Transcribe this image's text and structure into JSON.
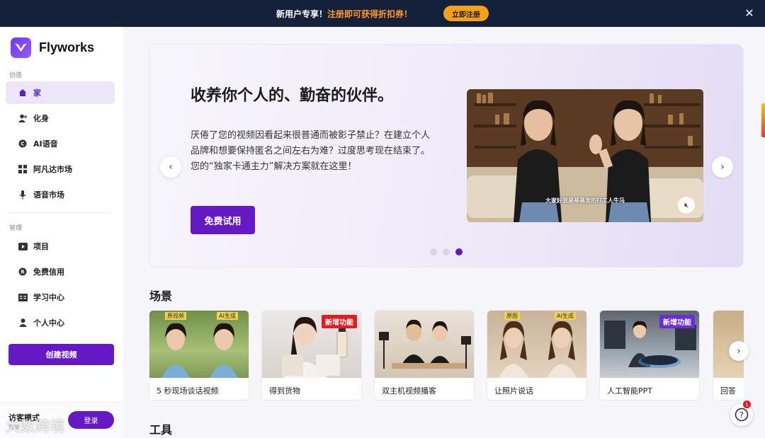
{
  "banner": {
    "prefix": "新用户专享！",
    "highlight": "注册即可获得折扣券！",
    "cta": "立即注册",
    "close_icon": "close-icon"
  },
  "sidebar": {
    "brand": "Flyworks",
    "section_create": "创造",
    "section_manage": "管理",
    "items_create": [
      {
        "label": "家",
        "icon": "home-icon",
        "active": true
      },
      {
        "label": "化身",
        "icon": "avatar-icon"
      },
      {
        "label": "AI语音",
        "icon": "voice-icon"
      },
      {
        "label": "阿凡达市场",
        "icon": "grid-icon"
      },
      {
        "label": "语音市场",
        "icon": "mic-icon"
      }
    ],
    "items_manage": [
      {
        "label": "项目",
        "icon": "play-icon"
      },
      {
        "label": "免费信用",
        "icon": "credit-icon"
      },
      {
        "label": "学习中心",
        "icon": "book-icon"
      },
      {
        "label": "个人中心",
        "icon": "user-icon"
      }
    ],
    "create_button": "创建视频",
    "guest_label": "访客模式",
    "guest_sub": "登录",
    "guest_button": "登录"
  },
  "hero": {
    "title": "收养你个人的、勤奋的伙伴。",
    "description": "厌倦了您的视频因看起来很普通而被影子禁止？在建立个人品牌和想要保持匿名之间左右为难？过度思考现在结束了。您的“独家卡通主力”解决方案就在这里！",
    "cta": "免费试用",
    "caption": "大家好我是蒂蒂发的打工人牛马",
    "active_dot": 3,
    "dot_count": 3
  },
  "scenes": {
    "title": "场景",
    "cards": [
      {
        "label": "5 秒现场谈话视频",
        "tag_left": "原视频",
        "tag_right": "AI生成"
      },
      {
        "label": "得到货物",
        "badge": "新增功能"
      },
      {
        "label": "双主机视频播客"
      },
      {
        "label": "让照片说话",
        "tag_left": "原图",
        "tag_right": "AI生成"
      },
      {
        "label": "人工智能PPT",
        "badge": "新增功能"
      },
      {
        "label": "回答"
      }
    ]
  },
  "tools": {
    "title": "工具"
  },
  "help": {
    "badge": "1"
  },
  "watermark": "大数跨境",
  "colors": {
    "accent": "#6519c4",
    "banner_bg": "#15203a",
    "banner_cta": "#f4a11a",
    "badge_red": "#e31b23"
  }
}
